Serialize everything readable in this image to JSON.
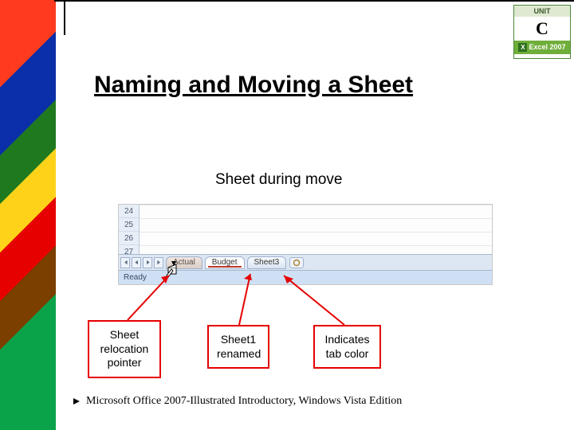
{
  "badge": {
    "unit": "UNIT",
    "letter": "C",
    "app": "Excel 2007"
  },
  "title": "Naming and Moving a Sheet",
  "subtitle": "Sheet during move",
  "excel": {
    "rows": [
      "24",
      "25",
      "26",
      "27"
    ],
    "tab_drag": "Actual",
    "tab_renamed": "Budget",
    "tab3": "Sheet3",
    "status": "Ready"
  },
  "callouts": {
    "relocation": "Sheet relocation pointer",
    "renamed": "Sheet1 renamed",
    "tabcolor": "Indicates tab color"
  },
  "footer": "Microsoft Office 2007-Illustrated Introductory, Windows Vista Edition"
}
